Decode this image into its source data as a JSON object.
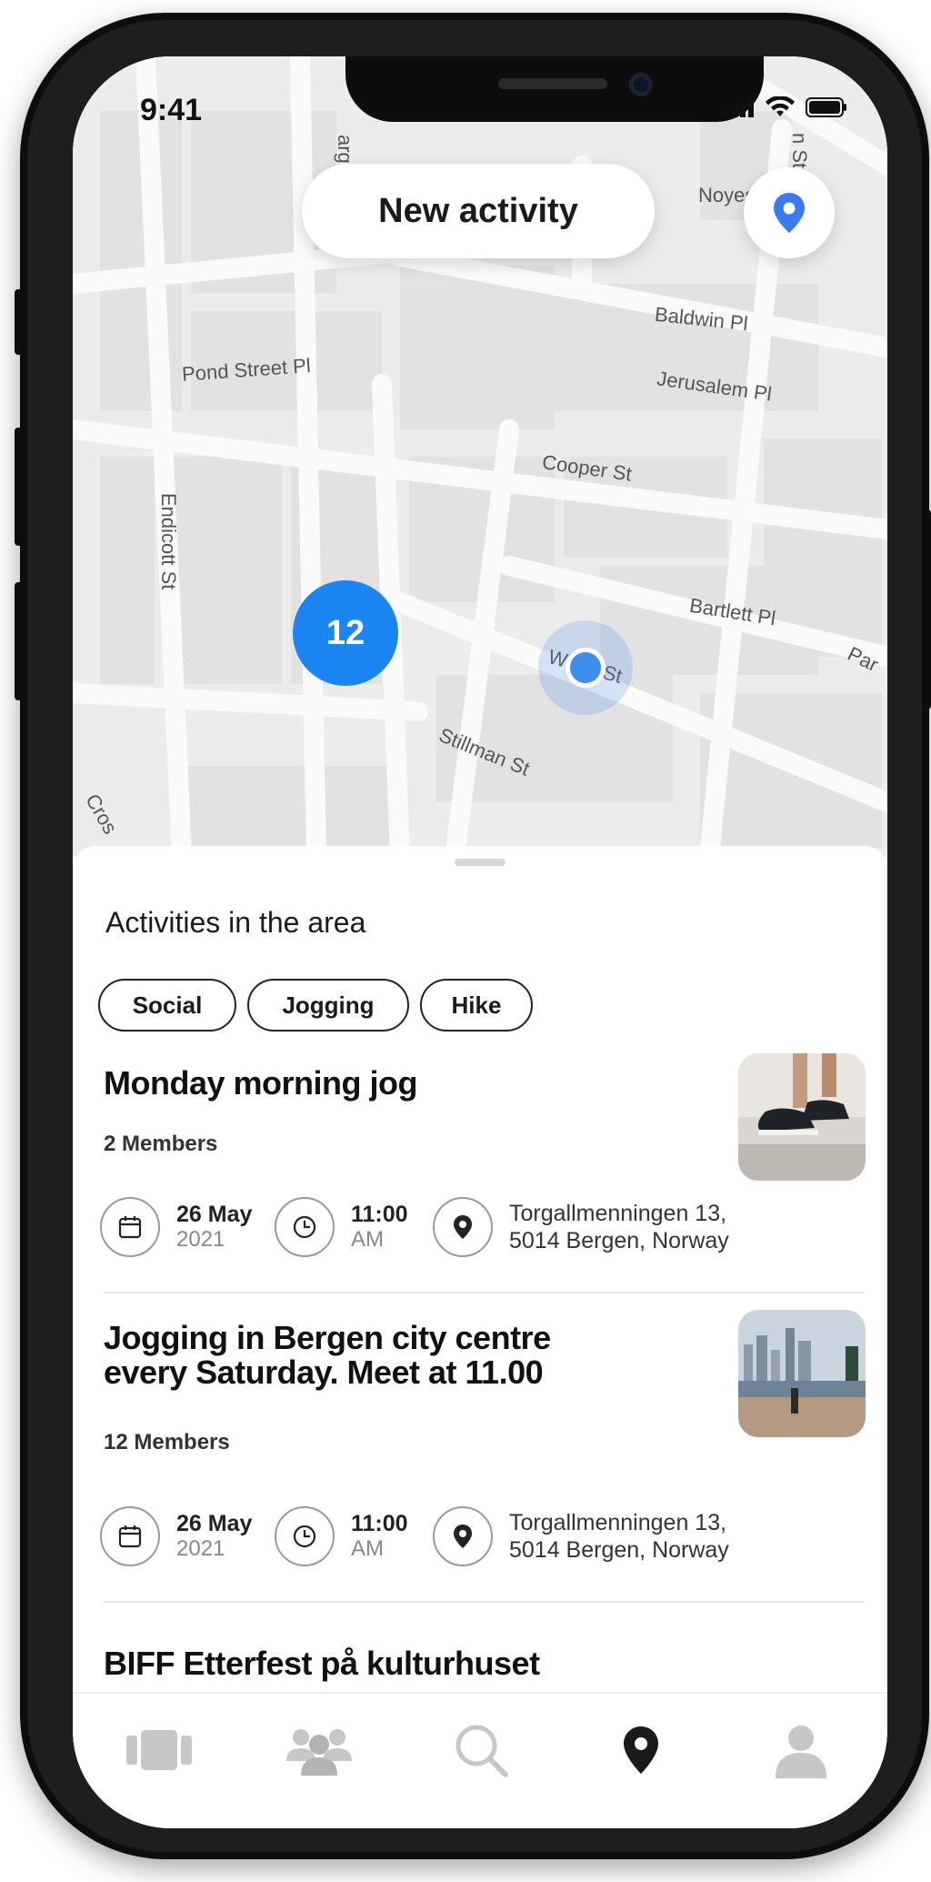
{
  "status": {
    "time": "9:41"
  },
  "map": {
    "new_activity_label": "New activity",
    "cluster_count": "12",
    "streets": {
      "pond": "Pond Street Pl",
      "baldwin": "Baldwin Pl",
      "jerusalem": "Jerusalem Pl",
      "cooper": "Cooper St",
      "endicott": "Endicott St",
      "bartlett": "Bartlett Pl",
      "wiget": "Wiget St",
      "stillman": "Stillman St",
      "noyes": "Noyes",
      "parmenter": "Par",
      "margin": "argi",
      "north": "n St",
      "cross": "Cros"
    },
    "accent_color": "#1b85f2",
    "user_dot_color": "#3c8dec"
  },
  "sheet": {
    "title": "Activities in the area",
    "chips": [
      "Social",
      "Jogging",
      "Hike"
    ],
    "activities": [
      {
        "title": "Monday morning jog",
        "members": "2 Members",
        "date_day": "26 May",
        "date_year": "2021",
        "time": "11:00",
        "period": "AM",
        "address_line1": "Torgallmenningen 13,",
        "address_line2": "5014 Bergen, Norway"
      },
      {
        "title_line1": "Jogging in Bergen city centre",
        "title_line2": "every Saturday. Meet at 11.00",
        "members": "12 Members",
        "date_day": "26 May",
        "date_year": "2021",
        "time": "11:00",
        "period": "AM",
        "address_line1": "Torgallmenningen 13,",
        "address_line2": "5014 Bergen, Norway"
      },
      {
        "title": "BIFF Etterfest på kulturhuset"
      }
    ]
  },
  "tabbar": {
    "icons": [
      "cards-icon",
      "group-icon",
      "search-icon",
      "map-pin-icon",
      "profile-icon"
    ],
    "active": "map-pin-icon"
  }
}
